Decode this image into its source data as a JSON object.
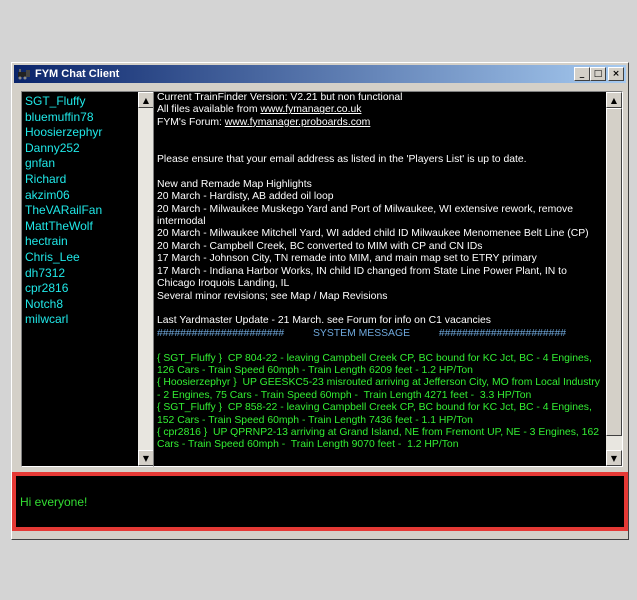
{
  "window": {
    "title": "FYM Chat Client",
    "buttons": {
      "minimize": "_",
      "maximize": "□",
      "close": "×"
    }
  },
  "users": [
    "SGT_Fluffy",
    "bluemuffin78",
    "Hoosierzephyr",
    "Danny252",
    "gnfan",
    "Richard",
    "akzim06",
    "TheVARailFan",
    "MattTheWolf",
    "hectrain",
    "Chris_Lee",
    "dh7312",
    "cpr2816",
    "Notch8",
    "milwcarl"
  ],
  "chat": {
    "lines": [
      {
        "text": "Current TrainFinder Version: V2.21 but non functional",
        "style": "white"
      },
      {
        "text": "All files available from ",
        "link": "www.fymanager.co.uk",
        "style": "white"
      },
      {
        "text": "FYM's Forum: ",
        "link": "www.fymanager.proboards.com",
        "style": "white"
      },
      {
        "text": "",
        "style": "white"
      },
      {
        "text": "",
        "style": "white"
      },
      {
        "text": "Please ensure that your email address as listed in the 'Players List' is up to date.",
        "style": "white"
      },
      {
        "text": "",
        "style": "white"
      },
      {
        "text": "New and Remade Map Highlights",
        "style": "white"
      },
      {
        "text": "20 March - Hardisty, AB added oil loop",
        "style": "white"
      },
      {
        "text": "20 March - Milwaukee Muskego Yard and Port of Milwaukee, WI extensive rework, remove intermodal",
        "style": "white"
      },
      {
        "text": "20 March - Milwaukee Mitchell Yard, WI added child ID Milwaukee Menomenee Belt Line (CP)",
        "style": "white"
      },
      {
        "text": "20 March - Campbell Creek, BC converted to MIM with CP and CN IDs",
        "style": "white"
      },
      {
        "text": "17 March - Johnson City, TN remade into MIM, and main map set to ETRY primary",
        "style": "white"
      },
      {
        "text": "17 March - Indiana Harbor Works, IN child ID changed from State Line Power Plant, IN to Chicago Iroquois Landing, IL",
        "style": "white"
      },
      {
        "text": "Several minor revisions; see Map / Map Revisions",
        "style": "white"
      },
      {
        "text": "",
        "style": "white"
      },
      {
        "text": "Last Yardmaster Update - 21 March. see Forum for info on C1 vacancies",
        "style": "white"
      },
      {
        "text": "######################          SYSTEM MESSAGE          ######################",
        "style": "sys"
      },
      {
        "text": "",
        "style": "white"
      },
      {
        "text": "{ SGT_Fluffy }  CP 804-22 - leaving Campbell Creek CP, BC bound for KC Jct, BC - 4 Engines, 126 Cars - Train Speed 60mph - Train Length 6209 feet - 1.2 HP/Ton",
        "style": "green"
      },
      {
        "text": "{ Hoosierzephyr }  UP GEESKC5-23 misrouted arriving at Jefferson City, MO from Local Industry - 2 Engines, 75 Cars - Train Speed 60mph -  Train Length 4271 feet -  3.3 HP/Ton",
        "style": "green"
      },
      {
        "text": "{ SGT_Fluffy }  CP 858-22 - leaving Campbell Creek CP, BC bound for KC Jct, BC - 4 Engines, 152 Cars - Train Speed 60mph - Train Length 7436 feet - 1.1 HP/Ton",
        "style": "green"
      },
      {
        "text": "{ cpr2816 }  UP QPRNP2-13 arriving at Grand Island, NE from Fremont UP, NE - 3 Engines, 162 Cars - Train Speed 60mph -  Train Length 9070 feet -  1.2 HP/Ton",
        "style": "green"
      }
    ]
  },
  "input": {
    "value": "Hi everyone!"
  },
  "colors": {
    "highlight_border": "#e53935",
    "user_text": "#20e8e8",
    "chat_green": "#33ee33",
    "system_blue": "#6fa8dc"
  }
}
